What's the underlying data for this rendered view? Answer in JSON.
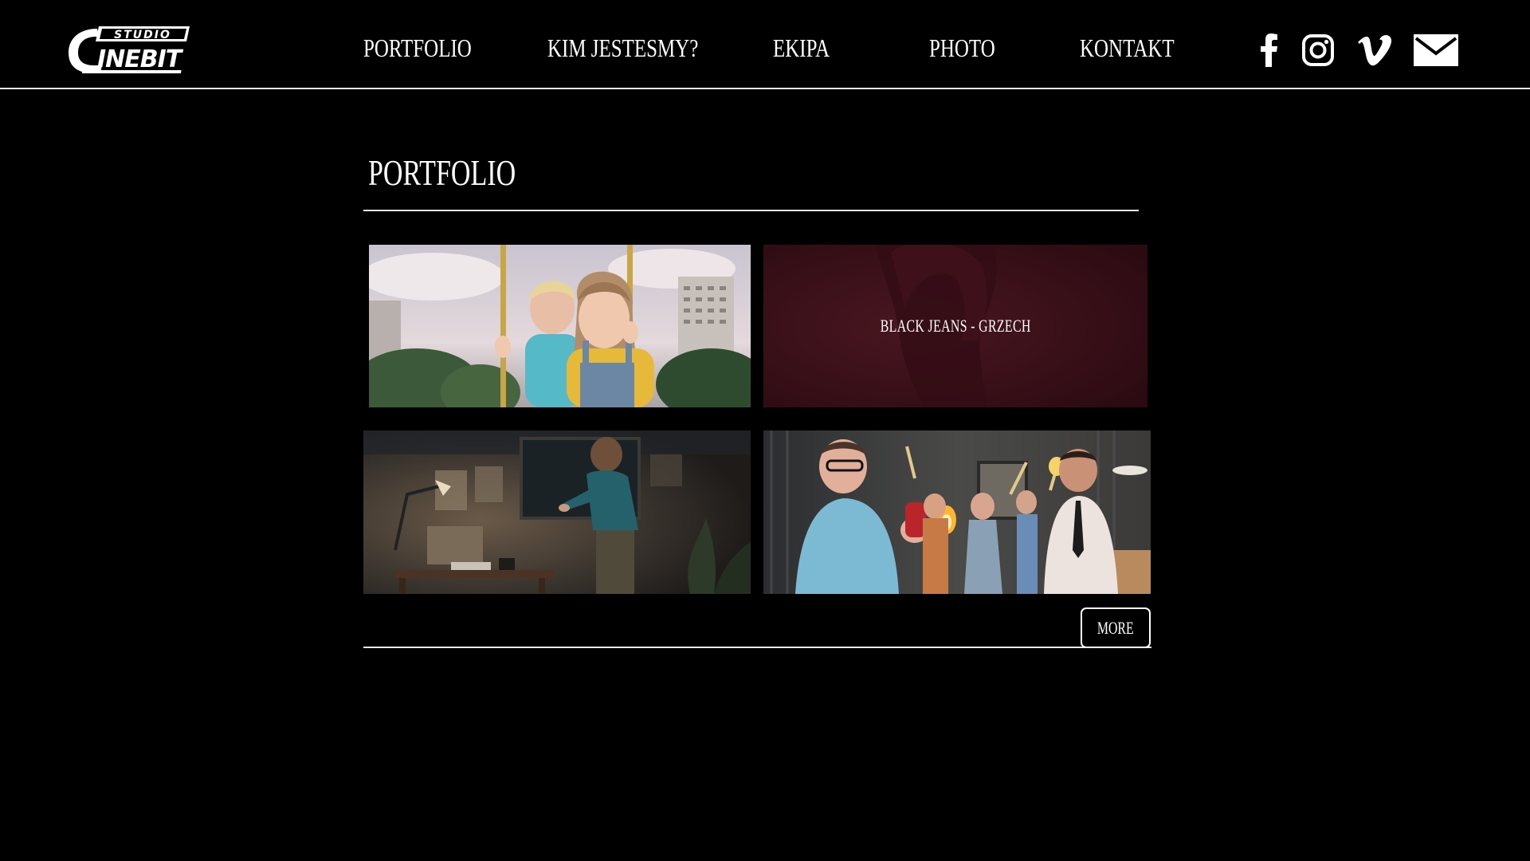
{
  "brand": {
    "logo_top": "STUDIO",
    "logo_main": "CINEBIT"
  },
  "nav": {
    "items": [
      {
        "label": "PORTFOLIO"
      },
      {
        "label": "KIM JESTESMY?"
      },
      {
        "label": "EKIPA"
      },
      {
        "label": "PHOTO"
      },
      {
        "label": "KONTAKT"
      }
    ]
  },
  "social": [
    {
      "icon": "facebook-icon"
    },
    {
      "icon": "instagram-icon"
    },
    {
      "icon": "vimeo-icon"
    },
    {
      "icon": "mail-icon"
    }
  ],
  "main": {
    "title": "PORTFOLIO",
    "tiles": [
      {
        "label": "",
        "scene": "children-on-swing"
      },
      {
        "label": "BLACK JEANS - GRZECH",
        "scene": "woman-dark-red"
      },
      {
        "label": "",
        "scene": "man-at-desk-room"
      },
      {
        "label": "",
        "scene": "party-with-sparklers"
      }
    ],
    "more_label": "MORE"
  },
  "colors": {
    "background": "#000000",
    "text": "#ffffff",
    "rule": "#e8e8e8",
    "hover_overlay": "#5a1a24"
  }
}
